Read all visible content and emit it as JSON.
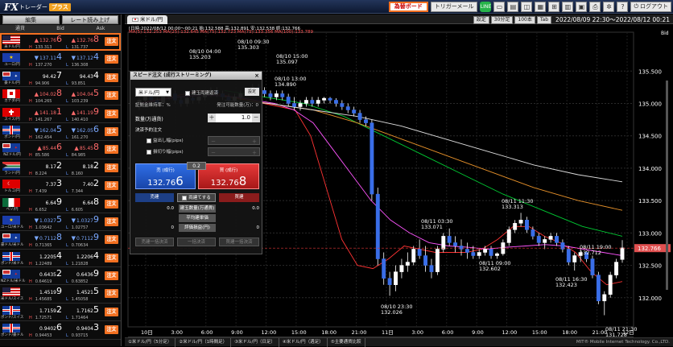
{
  "app": {
    "logo_fx": "FX",
    "logo_trader": "トレーダー",
    "logo_plus": "プラス"
  },
  "toolbar": {
    "speed_order": "為替ボード",
    "trigger_mail": "トリガーメール",
    "line_icon": "LINE",
    "logout": "ログアウト"
  },
  "left": {
    "tabs": [
      "編集",
      "レート読み上げ"
    ],
    "headers": [
      "通貨",
      "Bid",
      "Ask"
    ],
    "rows": [
      {
        "pair": "米ドル/円",
        "flag": "us",
        "dir": "up",
        "bid_main": "132.76",
        "bid_pip": "6",
        "ask_main": "132.76",
        "ask_pip": "8",
        "high": "133.313",
        "low": "131.737",
        "highlight": true
      },
      {
        "pair": "ユーロ/円",
        "flag": "eu",
        "dir": "dn",
        "bid_main": "137.11",
        "bid_pip": "4",
        "ask_main": "137.12",
        "ask_pip": "4",
        "high": "137.270",
        "low": "136.308"
      },
      {
        "pair": "豪ドル/円",
        "flag": "au",
        "dir": "",
        "bid_main": "94.42",
        "bid_pip": "7",
        "ask_main": "94.43",
        "ask_pip": "4",
        "high": "94.906",
        "low": "93.851"
      },
      {
        "pair": "カナダ/円",
        "flag": "ca",
        "dir": "up",
        "bid_main": "104.02",
        "bid_pip": "8",
        "ask_main": "104.04",
        "ask_pip": "5",
        "high": "104.265",
        "low": "103.239"
      },
      {
        "pair": "スイス/円",
        "flag": "ch",
        "dir": "up",
        "bid_main": "141.18",
        "bid_pip": "1",
        "ask_main": "141.19",
        "ask_pip": "9",
        "high": "141.267",
        "low": "140.410"
      },
      {
        "pair": "ポンド/円",
        "flag": "gb",
        "dir": "dn",
        "bid_main": "162.04",
        "bid_pip": "5",
        "ask_main": "162.05",
        "ask_pip": "6",
        "high": "162.454",
        "low": "161.270"
      },
      {
        "pair": "NZドル/円",
        "flag": "nz",
        "dir": "up",
        "bid_main": "85.44",
        "bid_pip": "6",
        "ask_main": "85.45",
        "ask_pip": "8",
        "high": "85.586",
        "low": "84.985"
      },
      {
        "pair": "ランド/円",
        "flag": "za",
        "dir": "",
        "bid_main": "8.17",
        "bid_pip": "2",
        "ask_main": "8.18",
        "ask_pip": "2",
        "high": "8.224",
        "low": "8.160"
      },
      {
        "pair": "トルコ/円",
        "flag": "tr",
        "dir": "",
        "bid_main": "7.37",
        "bid_pip": "3",
        "ask_main": "7.40",
        "ask_pip": "2",
        "high": "7.439",
        "low": "7.344"
      },
      {
        "pair": "ペソ/円",
        "flag": "mx",
        "dir": "",
        "bid_main": "6.64",
        "bid_pip": "9",
        "ask_main": "6.64",
        "ask_pip": "8",
        "high": "6.652",
        "low": "6.605"
      },
      {
        "pair": "ユーロ/米ドル",
        "flag": "eu",
        "dir": "dn",
        "bid_main": "1.0327",
        "bid_pip": "5",
        "ask_main": "1.0327",
        "ask_pip": "9",
        "high": "1.03642",
        "low": "1.02757"
      },
      {
        "pair": "豪ドル/米ドル",
        "flag": "au",
        "dir": "dn",
        "bid_main": "0.7112",
        "bid_pip": "8",
        "ask_main": "0.7112",
        "ask_pip": "9",
        "high": "0.71365",
        "low": "0.70634"
      },
      {
        "pair": "ポンド/米ドル",
        "flag": "gb",
        "dir": "",
        "bid_main": "1.2205",
        "bid_pip": "4",
        "ask_main": "1.2206",
        "ask_pip": "4",
        "high": "1.22489",
        "low": "1.21828"
      },
      {
        "pair": "NZドル/米ドル",
        "flag": "nz",
        "dir": "",
        "bid_main": "0.6435",
        "bid_pip": "2",
        "ask_main": "0.6436",
        "ask_pip": "9",
        "high": "0.64619",
        "low": "0.63852"
      },
      {
        "pair": "米ドル/スイス",
        "flag": "us",
        "dir": "",
        "bid_main": "1.4519",
        "bid_pip": "9",
        "ask_main": "1.4521",
        "ask_pip": "5",
        "high": "1.45685",
        "low": "1.45058"
      },
      {
        "pair": "ポンド/スイス",
        "flag": "gb",
        "dir": "",
        "bid_main": "1.7159",
        "bid_pip": "2",
        "ask_main": "1.7162",
        "ask_pip": "5",
        "high": "1.72571",
        "low": "1.71464"
      },
      {
        "pair": "ポンド/豪ドル",
        "flag": "gb",
        "dir": "",
        "bid_main": "0.9402",
        "bid_pip": "6",
        "ask_main": "0.9404",
        "ask_pip": "3",
        "high": "0.94453",
        "low": "0.93715"
      }
    ],
    "h_label": "H",
    "l_label": "L",
    "order_label": "注文"
  },
  "chart": {
    "tab": "米ドル/円",
    "tools": [
      "設定",
      "30分足",
      "100本",
      "Tab"
    ],
    "range": "2022/08/09 22:30～2022/08/12 00:21",
    "ohlc_line": "[日時:2022/08/12 00:00～00:21 始:132.588 高:132.891 安:132.538 終:132.766",
    "ma_line": "MA(5):132.253  MA(25):132.645  MA(75):132.723  MA(75):133.356  MA(100):133.789",
    "y_unit": "Bid",
    "current_price": "132.766",
    "bottom_tabs": [
      "①米ドル/円（5分足）",
      "②米ドル/円（1時間足）",
      "③米ドル/円（日足）",
      "④米ドル/円（週足）",
      "⑤主要通貨比較"
    ],
    "footer": "MIT® Mobile Internet Technology. Co.,LTD.",
    "annotations": [
      {
        "t": "08/10 04:00",
        "v": "135.203"
      },
      {
        "t": "08/10 09:30",
        "v": "135.303"
      },
      {
        "t": "08/10 15:00",
        "v": "135.097"
      },
      {
        "t": "08/10 13:00",
        "v": "134.890"
      },
      {
        "t": "08/11 03:30",
        "v": "133.071"
      },
      {
        "t": "08/11 11:30",
        "v": "133.313"
      },
      {
        "t": "08/11 09:00",
        "v": "132.602"
      },
      {
        "t": "08/11 19:00",
        "v": "132.712"
      },
      {
        "t": "08/11 16:30",
        "v": "132.423"
      },
      {
        "t": "08/10 23:30",
        "v": "132.026"
      },
      {
        "t": "08/11 21:30",
        "v": "131.728"
      }
    ]
  },
  "chart_data": {
    "type": "candlestick",
    "ylim": [
      131.55,
      136.1
    ],
    "y_ticks": [
      "135.500",
      "135.000",
      "134.500",
      "134.000",
      "133.500",
      "133.000",
      "132.500",
      "132.000"
    ],
    "x_ticks": [
      "10日",
      "3:00",
      "6:00",
      "9:00",
      "12:00",
      "15:00",
      "18:00",
      "21:00",
      "11日",
      "3:00",
      "6:00",
      "9:00",
      "12:00",
      "15:00",
      "18:00",
      "21:00",
      "12日"
    ],
    "candles": [
      [
        135.0,
        135.1,
        134.9,
        135.05
      ],
      [
        135.05,
        135.2,
        135.0,
        135.15
      ],
      [
        135.15,
        135.2,
        135.0,
        135.05
      ],
      [
        135.05,
        135.1,
        134.95,
        135.0
      ],
      [
        135.0,
        135.15,
        134.95,
        135.1
      ],
      [
        135.1,
        135.2,
        135.05,
        135.15
      ],
      [
        135.15,
        135.2,
        135.0,
        135.05
      ],
      [
        135.05,
        135.1,
        134.95,
        135.0
      ],
      [
        135.0,
        135.1,
        134.95,
        135.08
      ],
      [
        135.08,
        135.15,
        135.0,
        135.05
      ],
      [
        135.05,
        135.15,
        135.0,
        135.1
      ],
      [
        135.1,
        135.2,
        135.05,
        135.15
      ],
      [
        135.15,
        135.25,
        135.1,
        135.2
      ],
      [
        135.2,
        135.25,
        135.1,
        135.15
      ],
      [
        135.15,
        135.2,
        135.05,
        135.1
      ],
      [
        135.1,
        135.15,
        135.0,
        135.05
      ],
      [
        135.05,
        135.15,
        135.0,
        135.1
      ],
      [
        135.1,
        135.2,
        135.05,
        135.15
      ],
      [
        135.15,
        135.25,
        135.1,
        135.2
      ],
      [
        135.2,
        135.3,
        135.15,
        135.25
      ],
      [
        135.25,
        135.3,
        135.15,
        135.2
      ],
      [
        135.2,
        135.25,
        135.1,
        135.15
      ],
      [
        135.15,
        135.2,
        135.05,
        135.1
      ],
      [
        135.1,
        135.2,
        135.05,
        135.15
      ],
      [
        135.15,
        135.2,
        135.05,
        135.1
      ],
      [
        135.1,
        135.15,
        134.95,
        135.0
      ],
      [
        135.0,
        135.1,
        134.9,
        134.95
      ],
      [
        134.95,
        135.05,
        134.89,
        135.0
      ],
      [
        135.0,
        135.1,
        134.95,
        135.05
      ],
      [
        135.05,
        135.1,
        134.95,
        135.0
      ],
      [
        135.0,
        135.1,
        134.95,
        135.05
      ],
      [
        135.05,
        135.1,
        135.0,
        135.08
      ],
      [
        135.08,
        135.1,
        135.0,
        135.05
      ],
      [
        135.05,
        135.08,
        134.95,
        135.0
      ],
      [
        135.0,
        135.05,
        134.9,
        134.95
      ],
      [
        134.95,
        135.0,
        134.85,
        134.9
      ],
      [
        134.9,
        134.95,
        134.8,
        134.85
      ],
      [
        134.85,
        134.9,
        134.7,
        134.75
      ],
      [
        134.75,
        134.8,
        134.65,
        134.7
      ],
      [
        134.7,
        134.75,
        133.5,
        133.6
      ],
      [
        133.6,
        133.7,
        132.5,
        132.6
      ],
      [
        132.6,
        132.7,
        132.2,
        132.3
      ],
      [
        132.3,
        132.4,
        132.03,
        132.2
      ],
      [
        132.2,
        132.5,
        132.1,
        132.4
      ],
      [
        132.4,
        132.6,
        132.3,
        132.5
      ],
      [
        132.5,
        132.7,
        132.4,
        132.55
      ],
      [
        132.55,
        132.8,
        132.5,
        132.75
      ],
      [
        132.75,
        132.9,
        132.6,
        132.65
      ],
      [
        132.65,
        132.8,
        132.4,
        132.5
      ],
      [
        132.5,
        132.6,
        132.3,
        132.4
      ],
      [
        132.4,
        132.8,
        132.35,
        132.75
      ],
      [
        132.75,
        133.0,
        132.7,
        132.95
      ],
      [
        132.95,
        133.07,
        132.8,
        132.85
      ],
      [
        132.85,
        132.95,
        132.7,
        132.8
      ],
      [
        132.8,
        132.9,
        132.65,
        132.75
      ],
      [
        132.75,
        132.85,
        132.6,
        132.7
      ],
      [
        132.7,
        132.8,
        132.6,
        132.65
      ],
      [
        132.65,
        132.75,
        132.6,
        132.7
      ],
      [
        132.7,
        132.8,
        132.65,
        132.75
      ],
      [
        132.75,
        132.8,
        132.6,
        132.65
      ],
      [
        132.65,
        132.7,
        132.6,
        132.68
      ],
      [
        132.68,
        132.9,
        132.65,
        132.85
      ],
      [
        132.85,
        133.1,
        132.8,
        133.05
      ],
      [
        133.05,
        133.2,
        133.0,
        133.15
      ],
      [
        133.15,
        133.31,
        133.1,
        133.2
      ],
      [
        133.2,
        133.25,
        133.0,
        133.05
      ],
      [
        133.05,
        133.1,
        132.9,
        132.95
      ],
      [
        132.95,
        133.0,
        132.8,
        132.85
      ],
      [
        132.85,
        132.95,
        132.75,
        132.9
      ],
      [
        132.9,
        133.0,
        132.85,
        132.95
      ],
      [
        132.95,
        133.0,
        132.8,
        132.85
      ],
      [
        132.85,
        132.9,
        132.7,
        132.75
      ],
      [
        132.75,
        132.8,
        132.5,
        132.55
      ],
      [
        132.55,
        132.7,
        132.42,
        132.65
      ],
      [
        132.65,
        132.75,
        132.55,
        132.7
      ],
      [
        132.7,
        132.72,
        132.55,
        132.6
      ],
      [
        132.6,
        132.65,
        132.3,
        132.35
      ],
      [
        132.35,
        132.4,
        131.9,
        131.95
      ],
      [
        131.95,
        132.1,
        131.73,
        132.05
      ],
      [
        132.05,
        132.4,
        132.0,
        132.35
      ],
      [
        132.35,
        132.6,
        132.3,
        132.55
      ],
      [
        132.59,
        132.89,
        132.54,
        132.77
      ]
    ],
    "ma": [
      {
        "name": "MA(5)",
        "color": "#ff3333",
        "values": [
          135.0,
          135.05,
          135.1,
          135.15,
          135.2,
          135.15,
          135.1,
          135.05,
          135.0,
          134.95,
          134.9,
          134.5,
          133.7,
          132.9,
          132.5,
          132.45,
          132.6,
          132.8,
          132.75,
          132.7,
          132.7,
          132.7,
          132.75,
          132.9,
          133.1,
          133.1,
          132.95,
          132.85,
          132.7,
          132.4,
          132.2,
          132.25
        ]
      },
      {
        "name": "MA(25)",
        "color": "#ff55ff",
        "values": [
          135.0,
          135.05,
          135.1,
          135.12,
          135.12,
          135.1,
          135.05,
          135.0,
          134.9,
          134.7,
          134.3,
          133.9,
          133.5,
          133.2,
          133.0,
          132.85,
          132.8,
          132.78,
          132.75,
          132.78,
          132.8,
          132.82,
          132.8,
          132.75,
          132.7,
          132.65
        ]
      },
      {
        "name": "MA(75)",
        "color": "#00cc33",
        "values": [
          135.2,
          135.1,
          135.0,
          134.8,
          134.5,
          134.2,
          133.9,
          133.6,
          133.35,
          133.1,
          132.95
        ]
      },
      {
        "name": "MA(75)",
        "color": "#e8922a",
        "values": [
          135.1,
          135.0,
          134.9,
          134.7,
          134.45,
          134.2,
          133.95,
          133.7,
          133.5,
          133.35
        ]
      },
      {
        "name": "MA(100)",
        "color": "#dddddd",
        "values": [
          135.05,
          135.0,
          134.9,
          134.8,
          134.65,
          134.45,
          134.25,
          134.05,
          133.9,
          133.79
        ]
      }
    ]
  },
  "dialog": {
    "title": "スピード注文 (成行ストリーミング)",
    "close": "×",
    "pair": "米ドル/円",
    "hedge_check": "建玉両建返済",
    "settings_btn": "設定",
    "margin_ratio": "証拠金維持率：%",
    "max_lots": "発注可能数量(万)：0",
    "qty_label": "数量(万通貨)",
    "qty": "1.0",
    "minus": "－",
    "plus": "＋",
    "settle_label": "決済予約注文",
    "take_profit": "益出し幅(pips)",
    "stop_loss": "損切り幅(pips)",
    "sell_label": "売 (成行)",
    "sell_main": "132.76",
    "sell_pip": "6",
    "buy_label": "買 (成行)",
    "buy_main": "132.76",
    "buy_pip": "8",
    "spread": "0.2",
    "sell_close": "売建",
    "hedge_close": "両建てする",
    "buy_close": "買建",
    "pos_label": "建玉数量(万通貨)",
    "avg_label": "平均建単価",
    "pl_label": "評価損益(円)",
    "sell_pos": "0.0",
    "buy_pos": "0.0",
    "sell_pl": "0",
    "buy_pl": "0",
    "btn_sell_all": "売建一括決済",
    "btn_all": "一括決済",
    "btn_buy_all": "買建一括決済"
  }
}
